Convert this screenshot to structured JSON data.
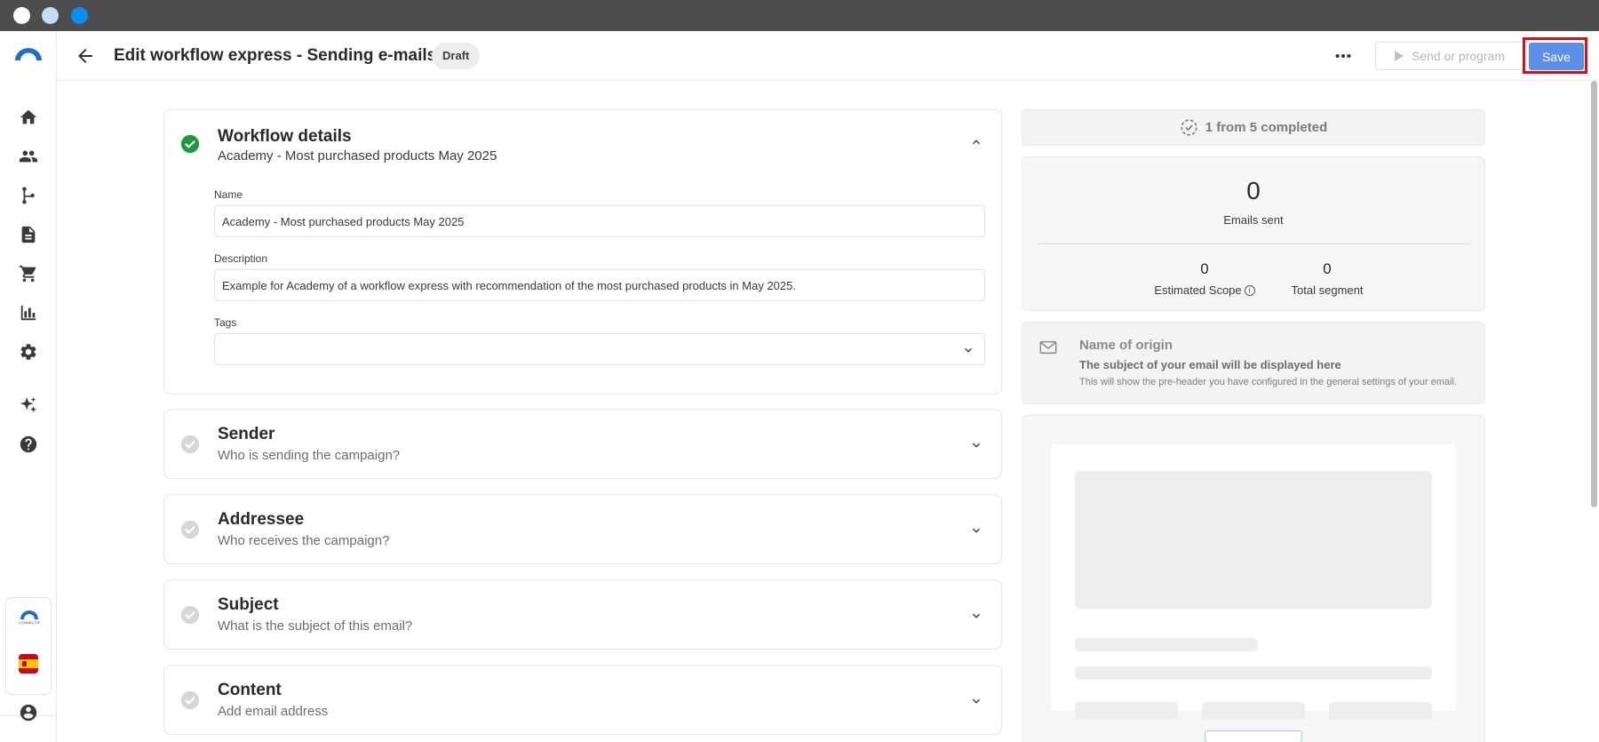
{
  "window": {
    "dots": [
      "#ffffff",
      "#c4def7",
      "#0a8ef0"
    ]
  },
  "sidebar": {
    "items": [
      {
        "name": "home-icon"
      },
      {
        "name": "contacts-icon"
      },
      {
        "name": "workflow-icon"
      },
      {
        "name": "document-icon"
      },
      {
        "name": "cart-icon"
      },
      {
        "name": "analytics-icon"
      },
      {
        "name": "settings-icon"
      },
      {
        "name": "ai-sparkle-icon"
      },
      {
        "name": "help-icon"
      }
    ],
    "brand_text": "CONNECTIF",
    "language_flag": "spain-flag-icon",
    "user_icon": "user-account-icon"
  },
  "header": {
    "title": "Edit workflow express - Sending e-mails",
    "status_badge": "Draft",
    "send_label": "Send or program",
    "save_label": "Save",
    "accent": "#5b8fe8"
  },
  "workflow_details": {
    "title": "Workflow details",
    "subtitle": "Academy - Most purchased products May 2025",
    "name_label": "Name",
    "name_value": "Academy - Most purchased products May 2025",
    "description_label": "Description",
    "description_value": "Example for Academy of a workflow express with recommendation of the most purchased products in May 2025.",
    "tags_label": "Tags",
    "tags_value": "",
    "completed_color": "#1d9a3f"
  },
  "sections": [
    {
      "title": "Sender",
      "subtitle": "Who is sending the campaign?"
    },
    {
      "title": "Addressee",
      "subtitle": "Who receives the campaign?"
    },
    {
      "title": "Subject",
      "subtitle": "What is the subject of this email?"
    },
    {
      "title": "Content",
      "subtitle": "Add email address"
    }
  ],
  "progress": {
    "label": "1 from 5 completed"
  },
  "stats": {
    "emails_sent_value": "0",
    "emails_sent_label": "Emails sent",
    "estimated_scope_value": "0",
    "estimated_scope_label": "Estimated Scope",
    "total_segment_value": "0",
    "total_segment_label": "Total segment"
  },
  "email_preview": {
    "origin_name": "Name of origin",
    "subject_placeholder": "The subject of your email will be displayed here",
    "preheader_note": "This will show the pre-header you have configured in the general settings of your email."
  }
}
